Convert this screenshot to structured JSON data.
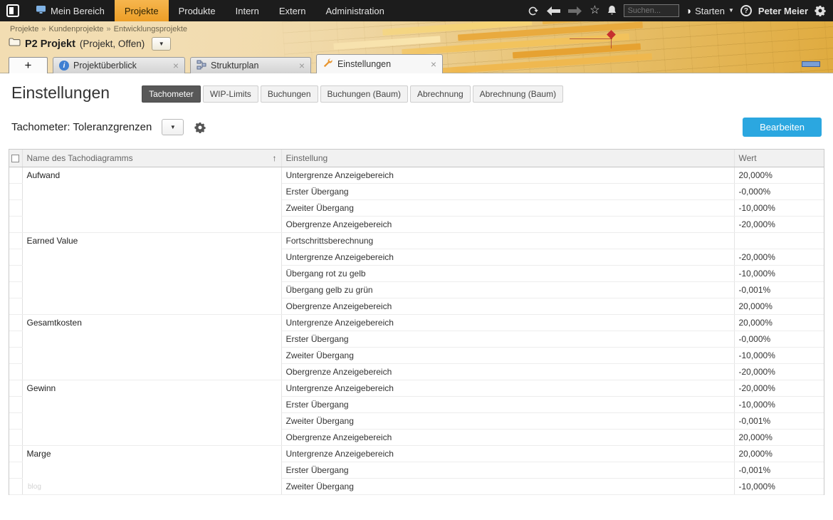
{
  "topnav": {
    "items": [
      {
        "label": "Mein Bereich"
      },
      {
        "label": "Projekte"
      },
      {
        "label": "Produkte"
      },
      {
        "label": "Intern"
      },
      {
        "label": "Extern"
      },
      {
        "label": "Administration"
      }
    ],
    "search_placeholder": "Suchen...",
    "start_label": "Starten",
    "user_name": "Peter Meier"
  },
  "breadcrumb": {
    "path": [
      "Projekte",
      "Kundenprojekte",
      "Entwicklungsprojekte"
    ],
    "separator": "»",
    "project_title": "P2 Projekt",
    "project_subtitle": "(Projekt, Offen)"
  },
  "tabs": [
    {
      "label": "Projektüberblick"
    },
    {
      "label": "Strukturplan"
    },
    {
      "label": "Einstellungen"
    }
  ],
  "page": {
    "title": "Einstellungen",
    "subtabs": [
      {
        "label": "Tachometer"
      },
      {
        "label": "WIP-Limits"
      },
      {
        "label": "Buchungen"
      },
      {
        "label": "Buchungen (Baum)"
      },
      {
        "label": "Abrechnung"
      },
      {
        "label": "Abrechnung (Baum)"
      }
    ],
    "section_title": "Tachometer: Toleranzgrenzen",
    "edit_button": "Bearbeiten"
  },
  "icons": {
    "star": "☆",
    "caret_down": "▼",
    "sort_asc": "↑",
    "plus": "+",
    "close": "×",
    "help": "?",
    "info": "i",
    "starten_circle": "◑"
  },
  "watermark": "blog",
  "table": {
    "columns": {
      "name": "Name des Tachodiagramms",
      "setting": "Einstellung",
      "wert": "Wert"
    },
    "groups": [
      {
        "name": "Aufwand",
        "rows": [
          {
            "setting": "Untergrenze Anzeigebereich",
            "value": "20,000%"
          },
          {
            "setting": "Erster Übergang",
            "value": "-0,000%"
          },
          {
            "setting": "Zweiter Übergang",
            "value": "-10,000%"
          },
          {
            "setting": "Obergrenze Anzeigebereich",
            "value": "-20,000%"
          }
        ]
      },
      {
        "name": "Earned Value",
        "rows": [
          {
            "setting": "Fortschrittsberechnung",
            "value": ""
          },
          {
            "setting": "Untergrenze Anzeigebereich",
            "value": "-20,000%"
          },
          {
            "setting": "Übergang rot zu gelb",
            "value": "-10,000%"
          },
          {
            "setting": "Übergang gelb zu grün",
            "value": "-0,001%"
          },
          {
            "setting": "Obergrenze Anzeigebereich",
            "value": "20,000%"
          }
        ]
      },
      {
        "name": "Gesamtkosten",
        "rows": [
          {
            "setting": "Untergrenze Anzeigebereich",
            "value": "20,000%"
          },
          {
            "setting": "Erster Übergang",
            "value": "-0,000%"
          },
          {
            "setting": "Zweiter Übergang",
            "value": "-10,000%"
          },
          {
            "setting": "Obergrenze Anzeigebereich",
            "value": "-20,000%"
          }
        ]
      },
      {
        "name": "Gewinn",
        "rows": [
          {
            "setting": "Untergrenze Anzeigebereich",
            "value": "-20,000%"
          },
          {
            "setting": "Erster Übergang",
            "value": "-10,000%"
          },
          {
            "setting": "Zweiter Übergang",
            "value": "-0,001%"
          },
          {
            "setting": "Obergrenze Anzeigebereich",
            "value": "20,000%"
          }
        ]
      },
      {
        "name": "Marge",
        "rows": [
          {
            "setting": "Untergrenze Anzeigebereich",
            "value": "20,000%"
          },
          {
            "setting": "Erster Übergang",
            "value": "-0,001%"
          },
          {
            "setting": "Zweiter Übergang",
            "value": "-10,000%"
          }
        ]
      }
    ]
  }
}
